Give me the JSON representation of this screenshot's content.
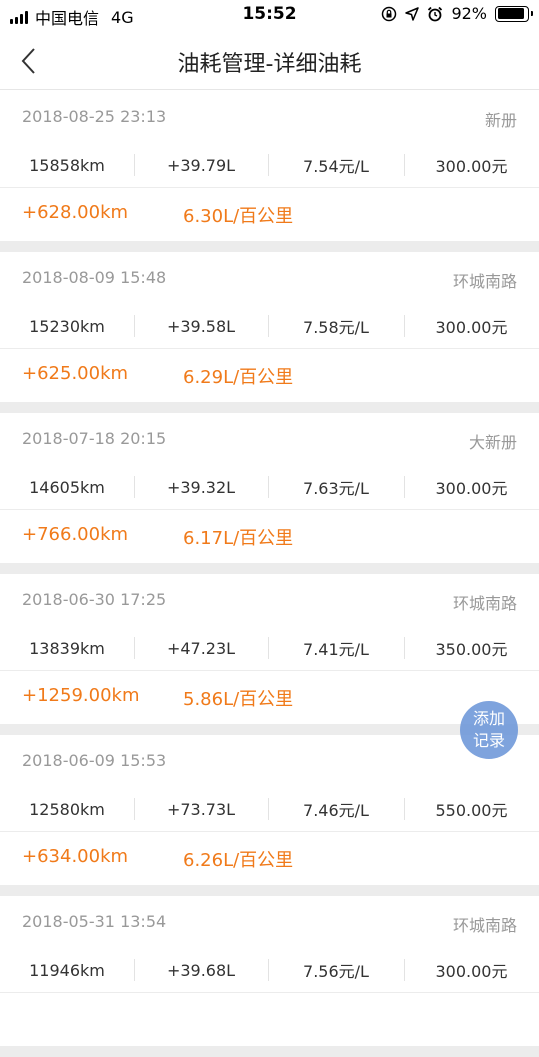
{
  "status_bar": {
    "carrier": "中国电信",
    "network": "4G",
    "time": "15:52",
    "battery": "92%",
    "battery_level": 0.92
  },
  "header": {
    "title": "油耗管理-详细油耗",
    "back_icon": "chevron-left-icon"
  },
  "records": [
    {
      "date": "2018-08-25 23:13",
      "station": "新册",
      "odometer": "15858km",
      "fuel": "+39.79L",
      "price": "7.54元/L",
      "amount": "300.00元",
      "distance": "+628.00km",
      "consumption": "6.30L/百公里"
    },
    {
      "date": "2018-08-09 15:48",
      "station": "环城南路",
      "odometer": "15230km",
      "fuel": "+39.58L",
      "price": "7.58元/L",
      "amount": "300.00元",
      "distance": "+625.00km",
      "consumption": "6.29L/百公里"
    },
    {
      "date": "2018-07-18 20:15",
      "station": "大新册",
      "odometer": "14605km",
      "fuel": "+39.32L",
      "price": "7.63元/L",
      "amount": "300.00元",
      "distance": "+766.00km",
      "consumption": "6.17L/百公里"
    },
    {
      "date": "2018-06-30 17:25",
      "station": "环城南路",
      "odometer": "13839km",
      "fuel": "+47.23L",
      "price": "7.41元/L",
      "amount": "350.00元",
      "distance": "+1259.00km",
      "consumption": "5.86L/百公里"
    },
    {
      "date": "2018-06-09 15:53",
      "station": "",
      "odometer": "12580km",
      "fuel": "+73.73L",
      "price": "7.46元/L",
      "amount": "550.00元",
      "distance": "+634.00km",
      "consumption": "6.26L/百公里"
    },
    {
      "date": "2018-05-31 13:54",
      "station": "环城南路",
      "odometer": "11946km",
      "fuel": "+39.68L",
      "price": "7.56元/L",
      "amount": "300.00元",
      "distance": "",
      "consumption": ""
    }
  ],
  "fab": {
    "line1": "添加",
    "line2": "记录"
  },
  "colors": {
    "accent": "#f07a1a",
    "fab": "#6c96d8",
    "muted_text": "#999999",
    "separator": "#ececec"
  }
}
